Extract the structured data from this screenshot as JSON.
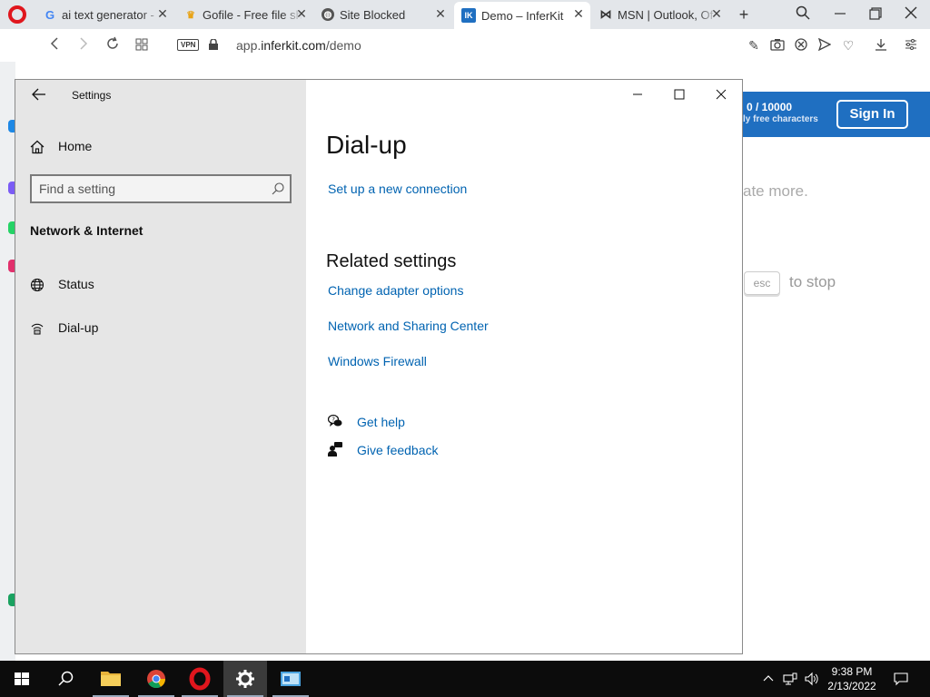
{
  "browser": {
    "tabs": [
      {
        "title": "ai text generator -",
        "favicon": "google-favicon"
      },
      {
        "title": "Gofile - Free file sh",
        "favicon": "gofile-favicon"
      },
      {
        "title": "Site Blocked",
        "favicon": "globe-favicon"
      },
      {
        "title": "Demo – InferKit",
        "favicon": "inferkit-favicon",
        "favicon_text": "IK"
      },
      {
        "title": "MSN | Outlook, Of",
        "favicon": "msn-favicon"
      }
    ],
    "address": {
      "vpn": "VPN",
      "url_prefix": "app.",
      "url_domain": "inferkit.com",
      "url_path": "/demo"
    }
  },
  "page_behind": {
    "count": "0 / 10000",
    "count_sub": "ly free characters",
    "sign_in": "Sign In",
    "generate_hint": "ate more.",
    "esc_key": "esc",
    "stop_text": "to stop"
  },
  "settings": {
    "window_title": "Settings",
    "home_label": "Home",
    "search_placeholder": "Find a setting",
    "section_title": "Network & Internet",
    "nav": [
      {
        "label": "Status",
        "icon": "globe-icon"
      },
      {
        "label": "Dial-up",
        "icon": "dial-up-icon"
      }
    ],
    "page_title": "Dial-up",
    "setup_link": "Set up a new connection",
    "related_title": "Related settings",
    "related_links": [
      "Change adapter options",
      "Network and Sharing Center",
      "Windows Firewall"
    ],
    "help": {
      "get_help": "Get help",
      "give_feedback": "Give feedback"
    }
  },
  "taskbar": {
    "time": "9:38 PM",
    "date": "2/13/2022"
  },
  "colors": {
    "link": "#0063b1",
    "inferkit_blue": "#1f6fc1",
    "opera_red": "#e0161d"
  }
}
